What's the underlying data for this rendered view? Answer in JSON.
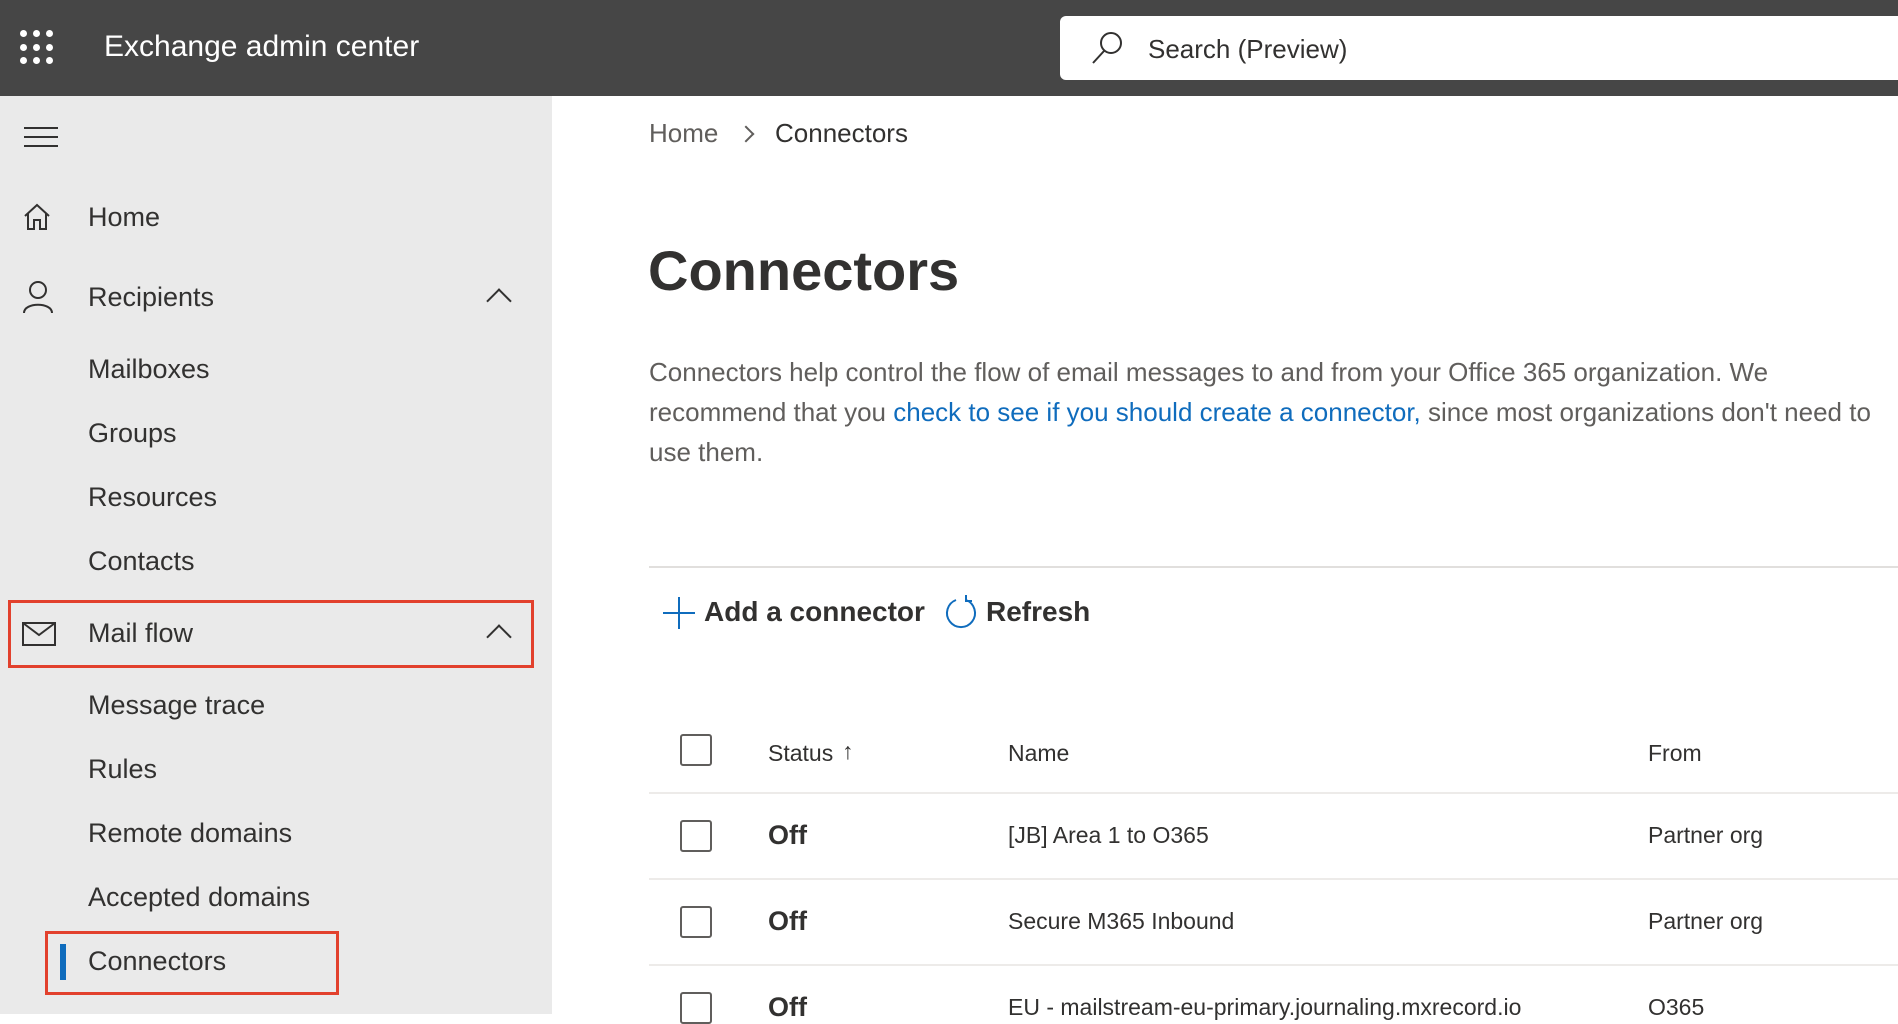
{
  "app": {
    "title": "Exchange admin center",
    "search_placeholder": "Search (Preview)"
  },
  "sidebar": {
    "items": [
      {
        "label": "Home"
      },
      {
        "label": "Recipients"
      },
      {
        "label": "Mailboxes"
      },
      {
        "label": "Groups"
      },
      {
        "label": "Resources"
      },
      {
        "label": "Contacts"
      },
      {
        "label": "Mail flow"
      },
      {
        "label": "Message trace"
      },
      {
        "label": "Rules"
      },
      {
        "label": "Remote domains"
      },
      {
        "label": "Accepted domains"
      },
      {
        "label": "Connectors"
      }
    ]
  },
  "breadcrumb": {
    "home": "Home",
    "current": "Connectors"
  },
  "page": {
    "title": "Connectors",
    "desc_1": "Connectors help control the flow of email messages to and from your Office 365 organization. We recommend that you ",
    "desc_link": "check to see if you should create a connector,",
    "desc_2": " since most organizations don't need to use them."
  },
  "toolbar": {
    "add": "Add a connector",
    "refresh": "Refresh"
  },
  "table": {
    "headers": {
      "status": "Status",
      "name": "Name",
      "from": "From"
    },
    "rows": [
      {
        "status": "Off",
        "name": "[JB] Area 1 to O365",
        "from": "Partner org"
      },
      {
        "status": "Off",
        "name": "Secure M365 Inbound",
        "from": "Partner org"
      },
      {
        "status": "Off",
        "name": "EU - mailstream-eu-primary.journaling.mxrecord.io",
        "from": "O365"
      }
    ]
  },
  "colors": {
    "accent": "#0f6cbd",
    "highlight": "#e2412d",
    "topbar": "#464646"
  }
}
